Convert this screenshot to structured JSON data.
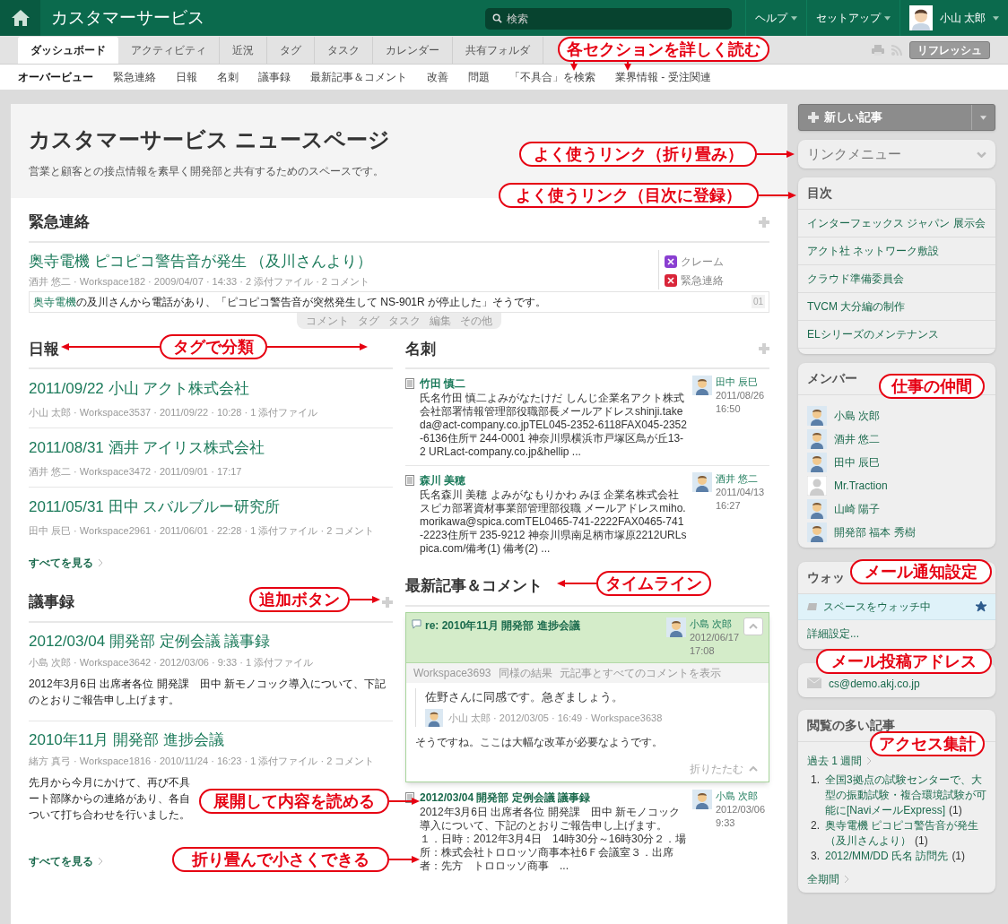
{
  "header": {
    "app_title": "カスタマーサービス",
    "search": {
      "placeholder": "検索"
    },
    "menus": [
      "ヘルプ",
      "セットアップ"
    ],
    "user": "小山 太郎"
  },
  "tabs": [
    {
      "label": "ダッシュボード",
      "selected": true
    },
    {
      "label": "アクティビティ",
      "selected": false
    },
    {
      "label": "近況",
      "selected": false
    },
    {
      "label": "タグ",
      "selected": false
    },
    {
      "label": "タスク",
      "selected": false
    },
    {
      "label": "カレンダー",
      "selected": false
    },
    {
      "label": "共有フォルダ",
      "selected": false
    }
  ],
  "refresh": "リフレッシュ",
  "subnav": [
    {
      "label": "オーバービュー",
      "selected": true
    },
    {
      "label": "緊急連絡",
      "selected": false
    },
    {
      "label": "日報",
      "selected": false
    },
    {
      "label": "名刺",
      "selected": false
    },
    {
      "label": "議事録",
      "selected": false
    },
    {
      "label": "最新記事＆コメント",
      "selected": false
    },
    {
      "label": "改善",
      "selected": false
    },
    {
      "label": "問題",
      "selected": false
    },
    {
      "label": "「不具合」を検索",
      "selected": false
    },
    {
      "label": "業界情報 - 受注関連",
      "selected": false
    }
  ],
  "page": {
    "title": "カスタマーサービス ニュースページ",
    "description": "営業と顧客との接点情報を素早く開発部と共有するためのスペースです。"
  },
  "urgent": {
    "heading": "緊急連絡",
    "post": {
      "title": "奥寺電機 ピコピコ警告音が発生 （及川さんより）",
      "meta": "酒井 悠二 · Workspace182 · 2009/04/07 · 14:33 · 2 添付ファイル · 2 コメント",
      "body_link": "奥寺電機",
      "body_rest": "の及川さんから電話があり、「ピコピコ警告音が突然発生して NS-901R が停止した」そうです。",
      "tags": [
        {
          "label": "クレーム",
          "color": "#8a3fd1"
        },
        {
          "label": "緊急連絡",
          "color": "#d9263a"
        }
      ]
    },
    "actions": [
      "コメント",
      "タグ",
      "タスク",
      "編集",
      "その他"
    ],
    "counter": "01"
  },
  "daily": {
    "heading": "日報",
    "items": [
      {
        "title": "2011/09/22 小山 アクト株式会社",
        "meta": "小山 太郎 · Workspace3537 · 2011/09/22 · 10:28 · 1 添付ファイル"
      },
      {
        "title": "2011/08/31 酒井 アイリス株式会社",
        "meta": "酒井 悠二 · Workspace3472 · 2011/09/01 · 17:17"
      },
      {
        "title": "2011/05/31 田中 スバルブルー研究所",
        "meta": "田中 辰巳 · Workspace2961 · 2011/06/01 · 22:28 · 1 添付ファイル · 2 コメント"
      }
    ],
    "see_all": "すべてを見る"
  },
  "cards": {
    "heading": "名刺",
    "items": [
      {
        "name": "竹田 慎二",
        "body": "氏名竹田 慎二よみがなたけだ しんじ企業名アクト株式会社部署情報管理部役職部長メールアドレスshinji.takeda@act-company.co.jpTEL045-2352-6118FAX045-2352-6136住所〒244-0001 神奈川県横浜市戸塚区鳥が丘13-2 URLact-company.co.jp&hellip ...",
        "author": "田中 辰巳",
        "date": "2011/08/26",
        "time": "16:50"
      },
      {
        "name": "森川 美穂",
        "body": "氏名森川 美穂 よみがなもりかわ みほ 企業名株式会社スピカ部署資材事業部管理部役職 メールアドレスmiho.morikawa@spica.comTEL0465-741-2222FAX0465-741-2223住所〒235-9212 神奈川県南足柄市塚原2212URLspica.com/備考(1) 備考(2) ...",
        "author": "酒井 悠二",
        "date": "2011/04/13",
        "time": "16:27"
      }
    ]
  },
  "minutes": {
    "heading": "議事録",
    "items": [
      {
        "title": "2012/03/04 開発部 定例会議 議事録",
        "meta": "小島 次郎 · Workspace3642 · 2012/03/06 · 9:33 · 1 添付ファイル",
        "body_lines": [
          "2012年3月6日 出席者各位 開発課　田中 新モノコック導入について、下記",
          "のとおりご報告申し上げます。"
        ]
      },
      {
        "title": "2010年11月 開発部 進捗会議",
        "meta": "緒方 真弓 · Workspace1816 · 2010/11/24 · 16:23 · 1 添付ファイル · 2 コメント",
        "body_lines": [
          "先月から今月にかけて、再び不具",
          "ート部隊からの連絡があり、各自",
          "ついて打ち合わせを行いました。"
        ]
      }
    ],
    "see_all": "すべてを見る"
  },
  "timeline": {
    "heading": "最新記事＆コメント",
    "items": [
      {
        "expanded": true,
        "title": "re: 2010年11月 開発部 進捗会議",
        "author": "小島 次郎",
        "date": "2012/06/17",
        "time": "17:08",
        "links": [
          "Workspace3693",
          "同様の結果",
          "元記事とすべてのコメントを表示"
        ],
        "quote": {
          "text": "佐野さんに同感です。急ぎましょう。",
          "meta": "小山 太郎 · 2012/03/05 · 16:49 · Workspace3638"
        },
        "body": "そうですね。ここは大幅な改革が必要なようです。",
        "collapse": "折りたたむ"
      },
      {
        "expanded": false,
        "title": "2012/03/04 開発部 定例会議 議事録",
        "body": "2012年3月6日 出席者各位 開発課　田中 新モノコック導入について、下記のとおりご報告申し上げます。１．日時：2012年3月4日　14時30分～16時30分２．場所：株式会社トロロッソ商事本社6Ｆ会議室３．出席者：先方　トロロッソ商事　...",
        "author": "小島 次郎",
        "date": "2012/03/06",
        "time": "9:33"
      }
    ]
  },
  "sidebar": {
    "new_post": "新しい記事",
    "link_menu": {
      "label": "リンクメニュー",
      "expanded": false
    },
    "toc": {
      "heading": "目次",
      "items": [
        "インターフェックス ジャパン 展示会",
        "アクト社 ネットワーク敷設",
        "クラウド準備委員会",
        "TVCM 大分編の制作",
        "ELシリーズのメンテナンス"
      ]
    },
    "members": {
      "heading": "メンバー",
      "items": [
        {
          "name": "小島 次郎",
          "kind": "avatar"
        },
        {
          "name": "酒井 悠二",
          "kind": "avatar"
        },
        {
          "name": "田中 辰巳",
          "kind": "avatar"
        },
        {
          "name": "Mr.Traction",
          "kind": "blank"
        },
        {
          "name": "山崎 陽子",
          "kind": "avatar"
        },
        {
          "name": "開発部 福本 秀樹",
          "kind": "avatar"
        }
      ]
    },
    "watch": {
      "heading": "ウォッ",
      "status": "スペースをウォッチ中",
      "starred": true,
      "settings": "詳細設定..."
    },
    "mail": {
      "address": "cs@demo.akj.co.jp"
    },
    "popular": {
      "heading": "閲覧の多い記事",
      "period": "過去 1 週間",
      "items": [
        {
          "rank": "1.",
          "title": "全国3拠点の試験センターで、大型の振動試験・複合環境試験が可能に[NaviメールExpress]",
          "count": "(1)"
        },
        {
          "rank": "2.",
          "title": "奥寺電機 ピコピコ警告音が発生（及川さんより）",
          "count": "(1)"
        },
        {
          "rank": "3.",
          "title": "2012/MM/DD 氏名 訪問先",
          "count": "(1)"
        }
      ],
      "all_period": "全期間"
    }
  },
  "callouts": [
    {
      "text": "各セクションを詳しく読む"
    },
    {
      "text": "よく使うリンク（折り畳み）"
    },
    {
      "text": "よく使うリンク（目次に登録）"
    },
    {
      "text": "タグで分類"
    },
    {
      "text": "仕事の仲間"
    },
    {
      "text": "追加ボタン"
    },
    {
      "text": "タイムライン"
    },
    {
      "text": "メール通知設定"
    },
    {
      "text": "メール投稿アドレス"
    },
    {
      "text": "展開して内容を読める"
    },
    {
      "text": "アクセス集計"
    },
    {
      "text": "折り畳んで小さくできる"
    }
  ]
}
